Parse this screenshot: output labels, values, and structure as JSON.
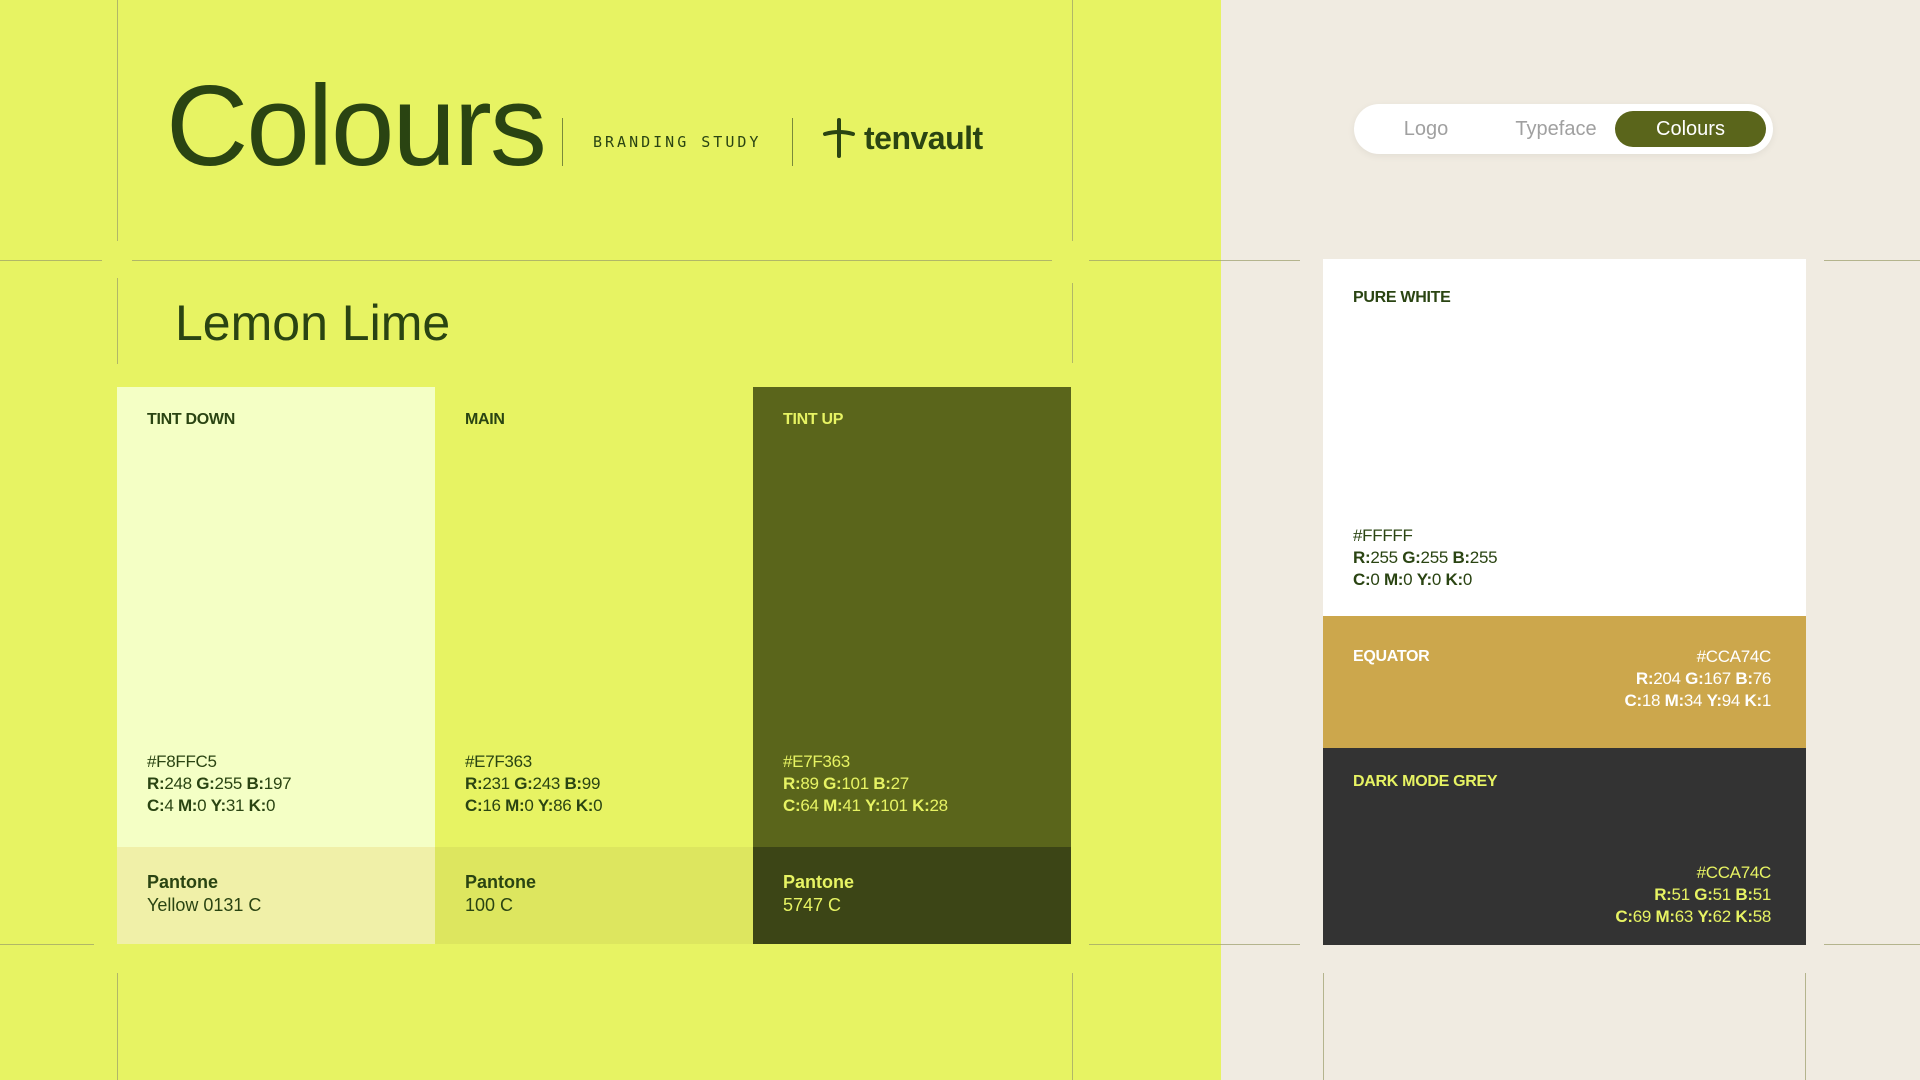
{
  "header": {
    "title": "Colours",
    "subtitle": "BRANDING STUDY",
    "logo_text": "tenvault"
  },
  "tabs": [
    {
      "label": "Logo",
      "active": false
    },
    {
      "label": "Typeface",
      "active": false
    },
    {
      "label": "Colours",
      "active": true
    }
  ],
  "palette": {
    "name": "Lemon Lime",
    "swatches": [
      {
        "label": "TINT DOWN",
        "hex": "#F8FFC5",
        "rgb": {
          "r": "248",
          "g": "255",
          "b": "197"
        },
        "cmyk": {
          "c": "4",
          "m": "0",
          "y": "31",
          "k": "0"
        },
        "pantone_title": "Pantone",
        "pantone_value": "Yellow 0131 C",
        "bg": "#F4FFC5",
        "pantone_bg": "#F0F0A8",
        "text_color": "#2A4412"
      },
      {
        "label": "MAIN",
        "hex": "#E7F363",
        "rgb": {
          "r": "231",
          "g": "243",
          "b": "99"
        },
        "cmyk": {
          "c": "16",
          "m": "0",
          "y": "86",
          "k": "0"
        },
        "pantone_title": "Pantone",
        "pantone_value": "100 C",
        "bg": "#E7F363",
        "pantone_bg": "#DDE65F",
        "text_color": "#2A4412"
      },
      {
        "label": "TINT UP",
        "hex": "#E7F363",
        "rgb": {
          "r": "89",
          "g": "101",
          "b": "27"
        },
        "cmyk": {
          "c": "64",
          "m": "41",
          "y": "101",
          "k": "28"
        },
        "pantone_title": "Pantone",
        "pantone_value": "5747 C",
        "bg": "#5A651B",
        "pantone_bg": "#3C4516",
        "text_color": "#E7F363"
      }
    ]
  },
  "secondary": {
    "pure_white": {
      "label": "PURE WHITE",
      "hex": "#FFFFF",
      "rgb": {
        "r": "255",
        "g": "255",
        "b": "255"
      },
      "cmyk": {
        "c": "0",
        "m": "0",
        "y": "0",
        "k": "0"
      },
      "bg": "#FFFFFF",
      "text_color": "#2A4412"
    },
    "equator": {
      "label": "EQUATOR",
      "hex": "#CCA74C",
      "rgb": {
        "r": "204",
        "g": "167",
        "b": "76"
      },
      "cmyk": {
        "c": "18",
        "m": "34",
        "y": "94",
        "k": "1"
      },
      "bg": "#CCA74C",
      "text_color": "#FFFFFF"
    },
    "dark_mode_grey": {
      "label": "DARK MODE GREY",
      "hex": "#CCA74C",
      "rgb": {
        "r": "51",
        "g": "51",
        "b": "51"
      },
      "cmyk": {
        "c": "69",
        "m": "63",
        "y": "62",
        "k": "58"
      },
      "bg": "#333333",
      "text_color": "#E7F363"
    }
  }
}
